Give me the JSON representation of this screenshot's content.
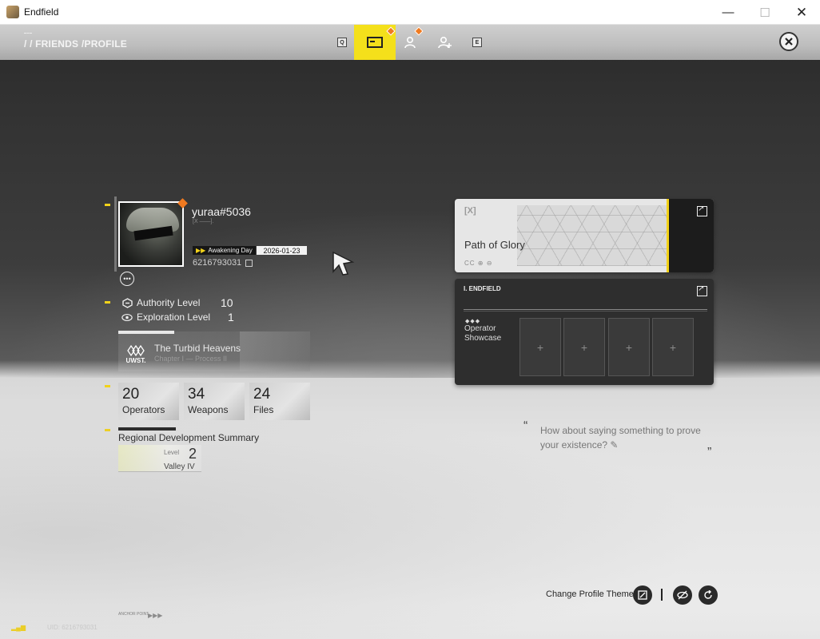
{
  "window": {
    "title": "Endfield"
  },
  "nav": {
    "breadcrumb_friends": "/ / FRIENDS",
    "breadcrumb_profile": "/PROFILE",
    "key_left": "Q",
    "key_right": "E"
  },
  "profile": {
    "username": "yuraa#5036",
    "subtag": "[X ——].",
    "awakening_label": "Awakening Day",
    "awakening_date": "2026-01-23",
    "uid": "6216793031",
    "authority_label": "Authority Level",
    "authority_value": "10",
    "exploration_label": "Exploration Level",
    "exploration_value": "1"
  },
  "story": {
    "logo_text": "UWST.",
    "title": "The Turbid Heavens",
    "subtitle": "Chapter I — Process II"
  },
  "stats": [
    {
      "value": "20",
      "label": "Operators"
    },
    {
      "value": "34",
      "label": "Weapons"
    },
    {
      "value": "24",
      "label": "Files"
    }
  ],
  "region": {
    "title": "Regional Development Summary",
    "level_label": "Level",
    "level_value": "2",
    "name": "Valley IV"
  },
  "glory": {
    "logo": "[X]",
    "title": "Path of Glory",
    "small": "CC ⊕ ⊖"
  },
  "showcase": {
    "header": "I. ENDFIELD",
    "title_line1": "Operator",
    "title_line2": "Showcase",
    "dots": "◆◆◆",
    "slot_symbol": "+"
  },
  "quote": {
    "open": "“",
    "close": "”",
    "text": "How about saying something to prove your existence?"
  },
  "bottom": {
    "theme_label": "Change Profile Theme",
    "anchor_text": "ANCHOR POINT",
    "arrows": "▶▶▶",
    "uid_text": "UID: 6216793031",
    "signal": "▂▄▆"
  },
  "colors": {
    "accent_yellow": "#f4e01b",
    "badge_orange": "#f07a20",
    "dark_card": "#2e2e2e"
  }
}
